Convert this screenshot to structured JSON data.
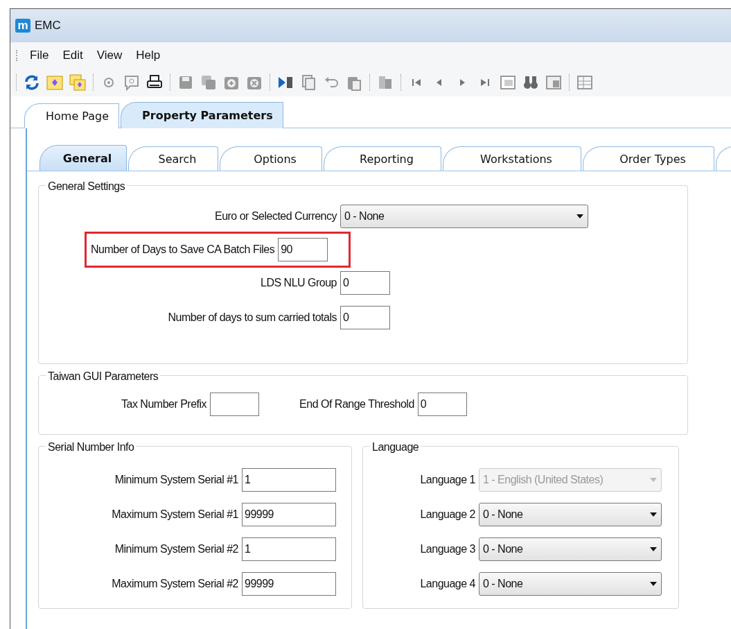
{
  "window": {
    "title": "EMC",
    "app_icon": "m"
  },
  "menu": [
    "File",
    "Edit",
    "View",
    "Help"
  ],
  "document_tabs": [
    {
      "label": "Home Page",
      "selected": false
    },
    {
      "label": "Property Parameters",
      "selected": true
    }
  ],
  "tabs": [
    {
      "label": "General",
      "selected": true
    },
    {
      "label": "Search",
      "selected": false
    },
    {
      "label": "Options",
      "selected": false
    },
    {
      "label": "Reporting",
      "selected": false
    },
    {
      "label": "Workstations",
      "selected": false
    },
    {
      "label": "Order Types",
      "selected": false
    }
  ],
  "general_settings": {
    "title": "General Settings",
    "fields": [
      {
        "label": "Euro or Selected Currency",
        "kind": "dropdown",
        "value": "0 - None",
        "highlighted": false
      },
      {
        "label": "Number of Days to Save CA Batch Files",
        "kind": "text",
        "value": "90",
        "highlighted": true
      },
      {
        "label": "LDS NLU Group",
        "kind": "text",
        "value": "0",
        "highlighted": false
      },
      {
        "label": "Number of days to sum carried totals",
        "kind": "text",
        "value": "0",
        "highlighted": false
      }
    ]
  },
  "taiwan_gui_parameters": {
    "title": "Taiwan GUI Parameters",
    "fields": [
      {
        "label": "Tax Number Prefix"
      },
      {
        "label": "End Of Range Threshold",
        "value": "0"
      }
    ]
  },
  "serial_number_info": {
    "title": "Serial Number Info",
    "fields": [
      {
        "label": "Minimum System Serial #1",
        "value": "1"
      },
      {
        "label": "Maximum System Serial #1",
        "value": "99999"
      },
      {
        "label": "Minimum System Serial #2",
        "value": "1"
      },
      {
        "label": "Maximum System Serial #2",
        "value": "99999"
      }
    ]
  },
  "language": {
    "title": "Language",
    "fields": [
      {
        "label": "Language 1",
        "value": "1 - English (United States)",
        "disabled": true
      },
      {
        "label": "Language 2",
        "value": "0 - None",
        "disabled": false
      },
      {
        "label": "Language 3",
        "value": "0 - None",
        "disabled": false
      },
      {
        "label": "Language 4",
        "value": "0 - None",
        "disabled": false
      }
    ]
  }
}
